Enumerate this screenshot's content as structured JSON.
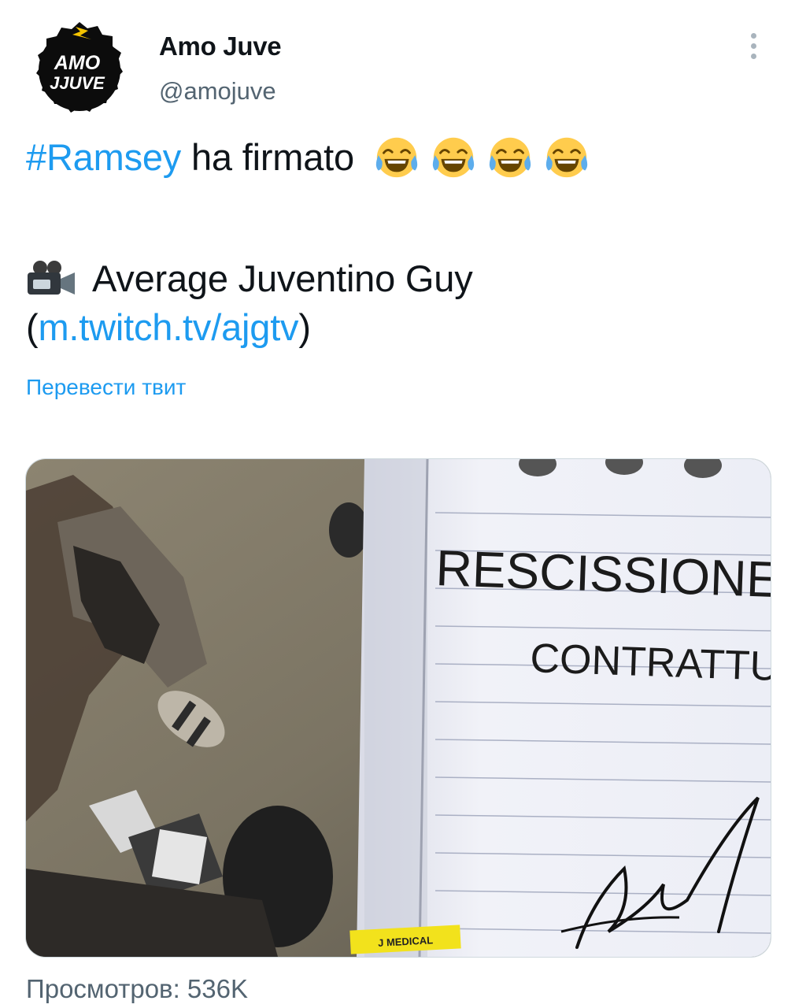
{
  "author": {
    "display_name": "Amo Juve",
    "handle": "@amojuve",
    "avatar_icon": "amo-juve-logo",
    "avatar_text_line1": "AMO",
    "avatar_text_line2": "JJUVE"
  },
  "tweet": {
    "hashtag": "#Ramsey",
    "text_after_hashtag": " ha firmato",
    "emoji": [
      "face-with-tears-of-joy",
      "face-with-tears-of-joy",
      "face-with-tears-of-joy",
      "face-with-tears-of-joy"
    ],
    "credit_icon": "movie-camera-icon",
    "credit_name": "Average Juventino Guy",
    "paren_open": "(",
    "credit_link": "m.twitch.tv/ajgtv",
    "paren_close": ")"
  },
  "translate_label": "Перевести твит",
  "media": {
    "notebook_line1": "RESCISSIONE",
    "notebook_line2": "CONTRATTU",
    "watermark": "J MEDICAL"
  },
  "views_label": "Просмотров: 536K",
  "colors": {
    "link": "#1d9bf0",
    "secondary_text": "#536471",
    "primary_text": "#0f1419"
  }
}
